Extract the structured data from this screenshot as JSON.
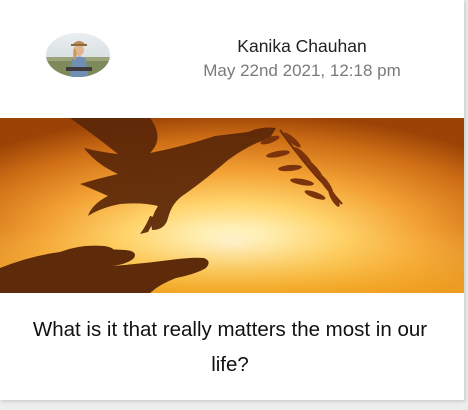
{
  "post": {
    "author_name": "Kanika Chauhan",
    "timestamp": "May 22nd 2021, 12:18 pm",
    "title": "What is it that really matters the most in our life?",
    "image_icon": "dove-over-hand-sunset-image",
    "avatar_icon": "author-avatar-photo"
  },
  "colors": {
    "page_background": "#ededed",
    "card_background": "#ffffff",
    "author_text": "#222222",
    "date_text": "#7a7a7a",
    "title_text": "#111111"
  }
}
